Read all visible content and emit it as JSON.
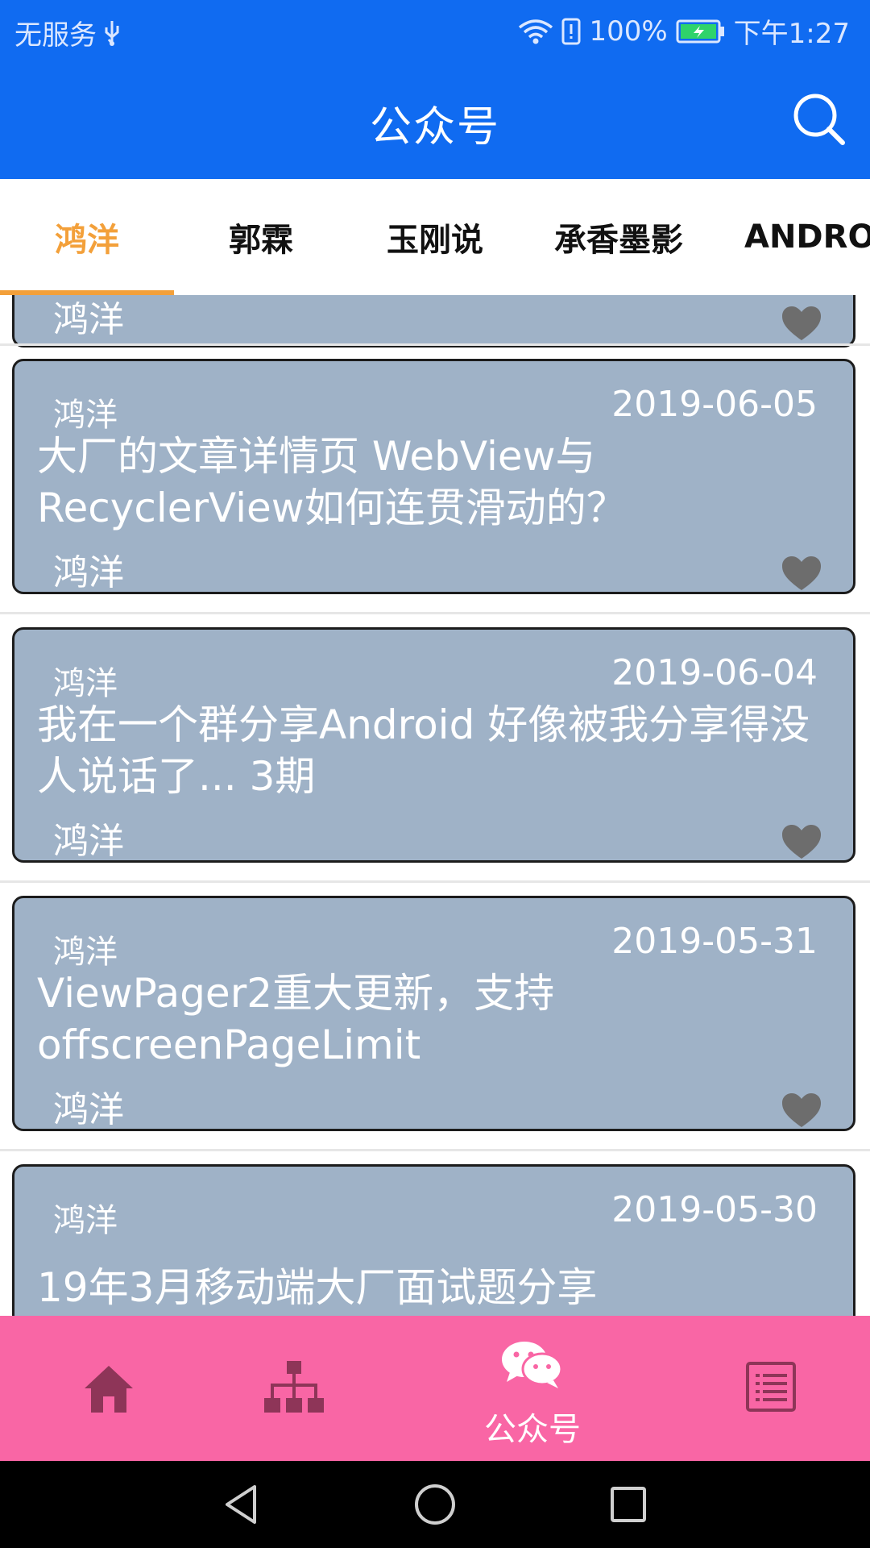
{
  "status_bar": {
    "carrier": "无服务",
    "battery_percent": "100%",
    "time": "下午1:27"
  },
  "app_bar": {
    "title": "公众号"
  },
  "tabs": [
    {
      "label": "鸿洋",
      "active": true
    },
    {
      "label": "郭霖",
      "active": false
    },
    {
      "label": "玉刚说",
      "active": false
    },
    {
      "label": "承香墨影",
      "active": false
    },
    {
      "label": "ANDROID",
      "active": false
    }
  ],
  "articles": [
    {
      "author_top": "鸿洋",
      "date": "",
      "title": "",
      "author_bottom": ""
    },
    {
      "author_top": "鸿洋",
      "date": "2019-06-05",
      "title": "大厂的文章详情页 WebView与RecyclerView如何连贯滑动的？",
      "author_bottom": "鸿洋"
    },
    {
      "author_top": "鸿洋",
      "date": "2019-06-04",
      "title": "我在一个群分享Android 好像被我分享得没人说话了... 3期",
      "author_bottom": "鸿洋"
    },
    {
      "author_top": "鸿洋",
      "date": "2019-05-31",
      "title": "ViewPager2重大更新，支持offscreenPageLimit",
      "author_bottom": "鸿洋"
    },
    {
      "author_top": "鸿洋",
      "date": "2019-05-30",
      "title": "19年3月移动端大厂面试题分享",
      "author_bottom": ""
    }
  ],
  "bottom_nav": {
    "items": [
      {
        "icon": "home-icon",
        "label": ""
      },
      {
        "icon": "tree-icon",
        "label": ""
      },
      {
        "icon": "wechat-icon",
        "label": "公众号"
      },
      {
        "icon": "list-icon",
        "label": ""
      }
    ],
    "active_index": 2
  },
  "colors": {
    "app_bar": "#106BF1",
    "tab_active": "#F3A03A",
    "card_bg": "#9FB2C7",
    "bottom_nav": "#F966A5",
    "nav_icon": "#8E3558"
  }
}
